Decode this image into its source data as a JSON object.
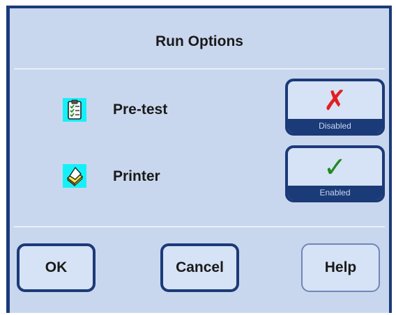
{
  "dialog": {
    "title": "Run Options",
    "options": [
      {
        "label": "Pre-test",
        "icon": "clipboard-checklist-icon",
        "toggle_mark": "✗",
        "toggle_mark_icon": "red-x-icon",
        "toggle_mark_color": "#e21e1e",
        "toggle_state": "Disabled"
      },
      {
        "label": "Printer",
        "icon": "printer-icon",
        "toggle_mark": "✓",
        "toggle_mark_icon": "green-check-icon",
        "toggle_mark_color": "#1f8a1f",
        "toggle_state": "Enabled"
      }
    ],
    "buttons": {
      "ok": "OK",
      "cancel": "Cancel",
      "help": "Help"
    }
  },
  "colors": {
    "frame": "#1b3a78",
    "background": "#c9d7ee",
    "icon_background": "#15f0f8"
  }
}
